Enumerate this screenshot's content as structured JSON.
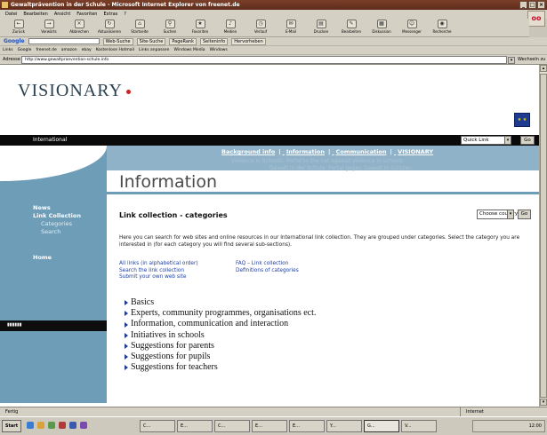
{
  "window": {
    "title": "Gewaltprävention in der Schule - Microsoft Internet Explorer von freenet.de",
    "controls": [
      "_",
      "□",
      "×"
    ],
    "brand_badge": "oo"
  },
  "menu": [
    "Datei",
    "Bearbeiten",
    "Ansicht",
    "Favoriten",
    "Extras",
    "?"
  ],
  "toolbar": [
    {
      "icon": "back-icon",
      "label": "Zurück"
    },
    {
      "icon": "forward-icon",
      "label": "Vorwärts"
    },
    {
      "icon": "stop-icon",
      "label": "Abbrechen"
    },
    {
      "icon": "refresh-icon",
      "label": "Aktualisieren"
    },
    {
      "icon": "home-icon",
      "label": "Startseite"
    },
    {
      "icon": "search-icon",
      "label": "Suchen"
    },
    {
      "icon": "favorites-icon",
      "label": "Favoriten"
    },
    {
      "icon": "media-icon",
      "label": "Medien"
    },
    {
      "icon": "history-icon",
      "label": "Verlauf"
    },
    {
      "icon": "mail-icon",
      "label": "E-Mail"
    },
    {
      "icon": "print-icon",
      "label": "Drucken"
    },
    {
      "icon": "edit-icon",
      "label": "Bearbeiten"
    },
    {
      "icon": "discuss-icon",
      "label": "Diskussion"
    },
    {
      "icon": "messenger-icon",
      "label": "Messenger"
    },
    {
      "icon": "research-icon",
      "label": "Recherche"
    }
  ],
  "google_bar": {
    "logo": "Google",
    "buttons": [
      "Web-Suche",
      "Site-Suche",
      "PageRank",
      "Seiteninfo",
      "Hervorheben"
    ]
  },
  "links_bar": [
    "Links",
    "Google",
    "freenet.de",
    "amazon",
    "ebay",
    "Kostenlose Hotmail",
    "Links anpassen",
    "Windows Media",
    "Windows"
  ],
  "address": {
    "label": "Adresse",
    "url": "http://www.gewaltpraevention-schule.info",
    "go": "Wechseln zu"
  },
  "site": {
    "logo": "VISIONARY",
    "eu_flag": "★ ★",
    "topbar": {
      "label": "International",
      "quicklink": "Quick Link",
      "go": "Go"
    },
    "nav": {
      "background_info": "Background info",
      "information": "Information",
      "communication": "Communication",
      "visionary": "VISIONARY",
      "separator": "|"
    },
    "faint_lines": [
      "Violence in Schools: Portal to the net against violence in schools",
      "Gewalt in der Schule: Portal gegen Gewalt in Schulen"
    ],
    "sidebar": {
      "news": "News",
      "link_collection": "Link Collection",
      "categories": "Categories",
      "search": "Search",
      "home": "Home",
      "black_label": "▮▮▮▮▮▮"
    },
    "page_title": "Information",
    "section_title": "Link collection - categories",
    "country": {
      "placeholder": "Choose country",
      "go": "Go"
    },
    "intro": "Here you can search for web sites and online resources in our International link collection. They are grouped under categories. Select the category you are interested in (for each category you will find several sub-sections).",
    "links_left": [
      "All links (in alphabetical order)",
      "Search the link collection",
      "Submit your own web site"
    ],
    "links_right": [
      "FAQ – Link collection",
      "Definitions of categories"
    ],
    "categories": [
      "Basics",
      "Experts, community programmes, organisations ect.",
      "Information, communication and interaction",
      "Initiatives in schools",
      "Suggestions for parents",
      "Suggestions for pupils",
      "Suggestions for teachers"
    ]
  },
  "status": {
    "text": "Fertig",
    "zone": "Internet"
  },
  "taskbar": {
    "start": "Start",
    "tasks": [
      "C...",
      "E...",
      "C...",
      "E...",
      "E...",
      "Y...",
      "G...",
      "V..."
    ],
    "clock": "12:00"
  }
}
